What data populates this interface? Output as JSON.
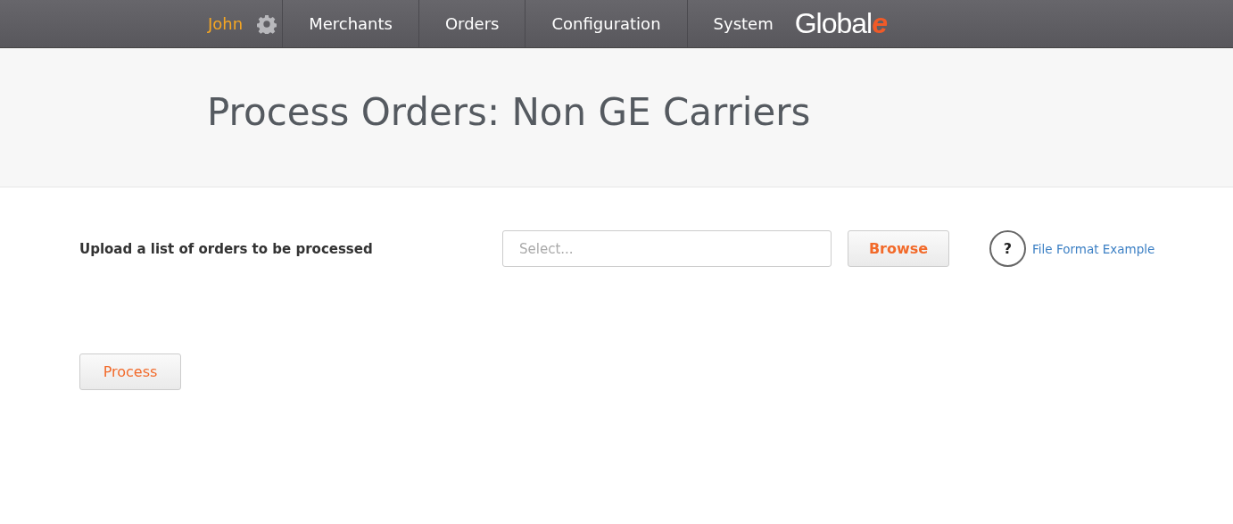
{
  "nav": {
    "user": "John",
    "items": [
      "Merchants",
      "Orders",
      "Configuration",
      "System"
    ],
    "logo": {
      "text": "Global",
      "mark": "e"
    }
  },
  "page_title": "Process Orders: Non GE Carriers",
  "upload": {
    "label": "Upload a list of orders to be processed",
    "placeholder": "Select...",
    "browse": "Browse",
    "help": "?",
    "link": "File Format Example"
  },
  "process_button": "Process"
}
